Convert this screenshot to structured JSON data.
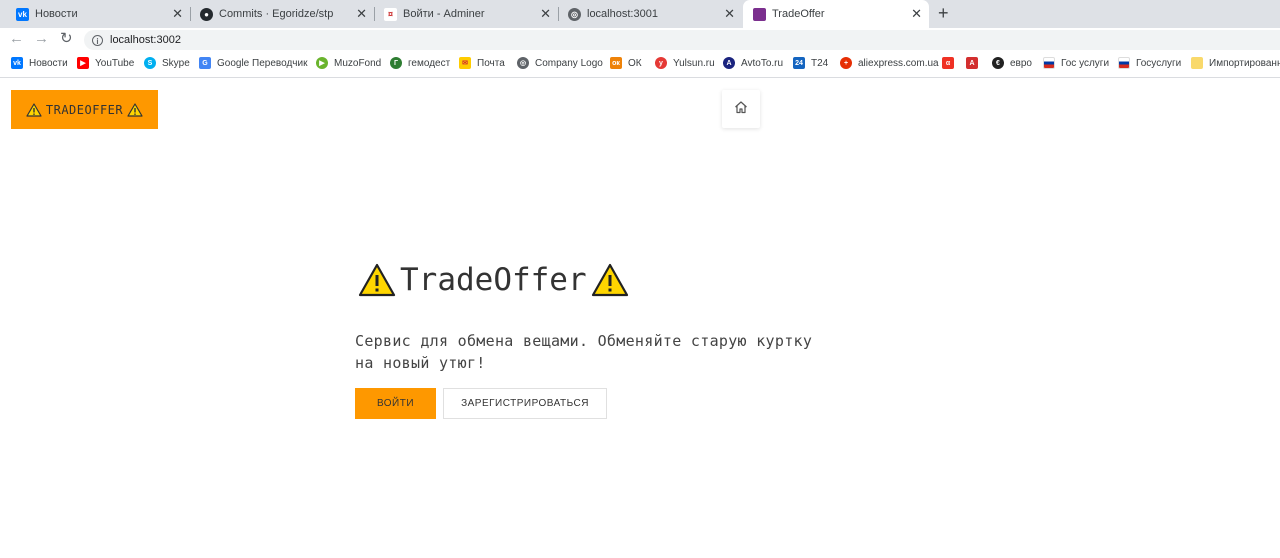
{
  "browser": {
    "tabs": [
      {
        "title": "Новости",
        "icon": "vk-icon",
        "color": "#0077ff"
      },
      {
        "title": "Commits · Egoridze/stp",
        "icon": "github-icon",
        "color": "#24292e"
      },
      {
        "title": "Войти - Adminer",
        "icon": "adminer-icon",
        "color": "#cc3333"
      },
      {
        "title": "localhost:3001",
        "icon": "globe-icon",
        "color": "#5f6368"
      },
      {
        "title": "TradeOffer",
        "icon": "tradeoffer-icon",
        "color": "#7b2f8e"
      }
    ],
    "new_tab_label": "+",
    "address": "localhost:3002",
    "bookmarks": [
      {
        "label": "Новости",
        "icon": "vk-icon",
        "color": "#0077ff"
      },
      {
        "label": "YouTube",
        "icon": "youtube-icon",
        "color": "#ff0000"
      },
      {
        "label": "Skype",
        "icon": "skype-icon",
        "color": "#00aff0"
      },
      {
        "label": "Google Переводчик",
        "icon": "google-translate-icon",
        "color": "#4285f4"
      },
      {
        "label": "MuzoFond",
        "icon": "muzofond-icon",
        "color": "#6ab42d"
      },
      {
        "label": "гемодест",
        "icon": "gemodest-icon",
        "color": "#2e7d32"
      },
      {
        "label": "Почта",
        "icon": "mail-icon",
        "color": "#ffcc00"
      },
      {
        "label": "Company Logo",
        "icon": "globe-icon",
        "color": "#5f6368"
      },
      {
        "label": "ОК",
        "icon": "ok-icon",
        "color": "#ee8208"
      },
      {
        "label": "Yulsun.ru",
        "icon": "yulsun-icon",
        "color": "#e53935"
      },
      {
        "label": "AvtoTo.ru",
        "icon": "avtoto-icon",
        "color": "#1a237e"
      },
      {
        "label": "Т24",
        "icon": "t24-icon",
        "color": "#1565c0"
      },
      {
        "label": "aliexpress.com.ua",
        "icon": "aliexpress-icon",
        "color": "#e62e04"
      },
      {
        "label": "",
        "icon": "alfa-icon",
        "color": "#ef3124"
      },
      {
        "label": "",
        "icon": "pdf-icon",
        "color": "#d32f2f"
      },
      {
        "label": "евро",
        "icon": "euro-icon",
        "color": "#212121"
      },
      {
        "label": "Гос услуги",
        "icon": "russia-flag-icon",
        "color": "#0039a6"
      },
      {
        "label": "Госуслуги",
        "icon": "russia-flag-icon",
        "color": "#0039a6"
      },
      {
        "label": "Импортированн",
        "icon": "folder-icon",
        "color": "#f9d96b"
      }
    ]
  },
  "page": {
    "brand": "TRADEOFFER",
    "hero_title": "TradeOffer",
    "subtitle": "Сервис для обмена вещами. Обменяйте старую куртку на новый утюг!",
    "login_label": "ВОЙТИ",
    "register_label": "ЗАРЕГИСТРИРОВАТЬСЯ",
    "accent_color": "#fe9800"
  }
}
